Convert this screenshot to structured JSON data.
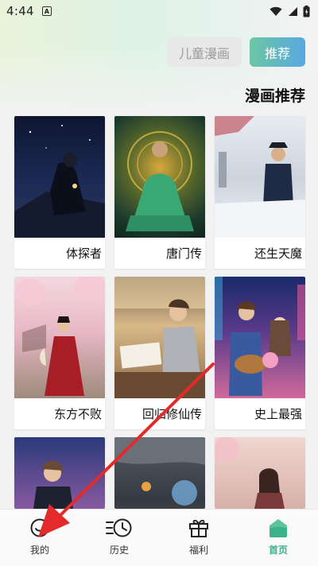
{
  "status_bar": {
    "time": "4:44",
    "notif_letter": "A"
  },
  "header": {
    "category_button": "儿童漫画",
    "recommend_button": "推荐",
    "section_title": "漫画推荐"
  },
  "comics": [
    {
      "title": "体探者"
    },
    {
      "title": "唐门传"
    },
    {
      "title": "还生天魔"
    },
    {
      "title": "东方不败"
    },
    {
      "title": "回归修仙传"
    },
    {
      "title": "史上最强"
    }
  ],
  "tab_bar": {
    "tabs": [
      {
        "label": "我的",
        "icon": "smile-icon"
      },
      {
        "label": "历史",
        "icon": "history-clock-icon"
      },
      {
        "label": "福利",
        "icon": "gift-icon"
      },
      {
        "label": "首页",
        "icon": "home-icon"
      }
    ]
  },
  "colors": {
    "accent": "#3bb38a",
    "arrow": "#e32b2b"
  }
}
